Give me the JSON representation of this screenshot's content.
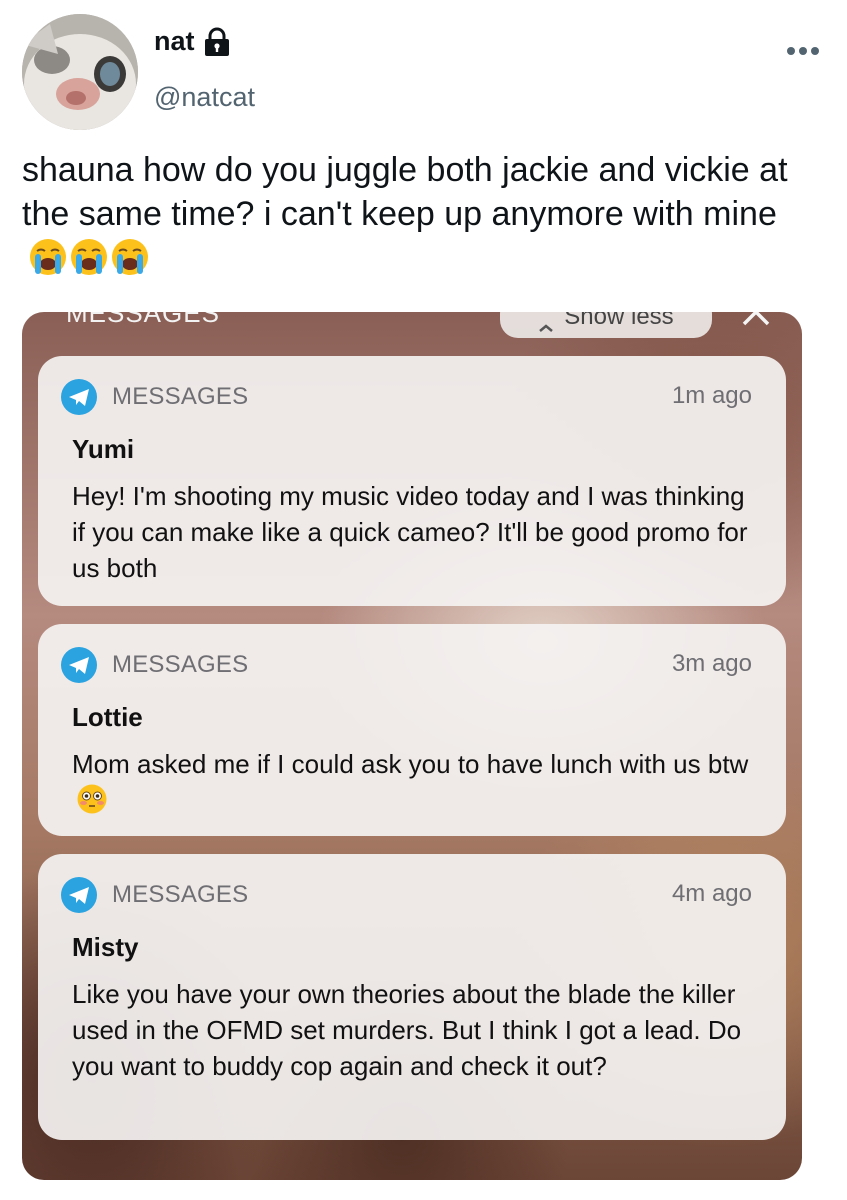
{
  "tweet": {
    "display_name": "nat",
    "handle": "@natcat",
    "text": "shauna how do you juggle both jackie and vickie at the same time? i can't keep up anymore with mine",
    "emojis": [
      "loudly-crying-face-icon",
      "loudly-crying-face-icon",
      "loudly-crying-face-icon"
    ],
    "locked": true
  },
  "screenshot": {
    "group_label": "MESSAGES",
    "show_less_label": "Show less",
    "notifications": [
      {
        "app": "MESSAGES",
        "time": "1m ago",
        "sender": "Yumi",
        "body": "Hey! I'm shooting my music video today and I was thinking if you can make like a quick cameo? It'll be good promo for us both"
      },
      {
        "app": "MESSAGES",
        "time": "3m ago",
        "sender": "Lottie",
        "body": "Mom asked me if I could ask you to have lunch with us btw",
        "trailing_emoji": "flushed-face-icon"
      },
      {
        "app": "MESSAGES",
        "time": "4m ago",
        "sender": "Misty",
        "body": "Like you have your own theories about the blade the killer used in the OFMD set murders. But I think I got a lead. Do you want to buddy cop again and check it out?"
      }
    ]
  },
  "colors": {
    "text_primary": "#0f1419",
    "text_secondary": "#536471",
    "app_icon_blue": "#2aa3e0",
    "card_background": "#f4f2f1"
  }
}
